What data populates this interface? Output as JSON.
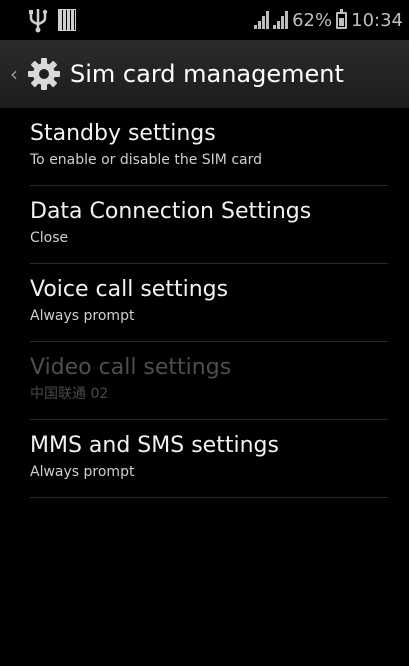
{
  "status_bar": {
    "battery_percent": "62%",
    "time": "10:34"
  },
  "action_bar": {
    "back_glyph": "‹",
    "title": "Sim card management",
    "icon": "gear-icon"
  },
  "settings": {
    "items": [
      {
        "title": "Standby settings",
        "summary": "To enable or disable the SIM card",
        "enabled": true
      },
      {
        "title": "Data Connection Settings",
        "summary": "Close",
        "enabled": true
      },
      {
        "title": "Voice call settings",
        "summary": "Always prompt",
        "enabled": true
      },
      {
        "title": "Video call settings",
        "summary": "中国联通 02",
        "enabled": false
      },
      {
        "title": "MMS and SMS settings",
        "summary": "Always prompt",
        "enabled": true
      }
    ]
  },
  "colors": {
    "background": "#000000",
    "action_bar": "#262626",
    "text_primary": "#f2f2f2",
    "text_disabled": "#4e4e4e"
  }
}
